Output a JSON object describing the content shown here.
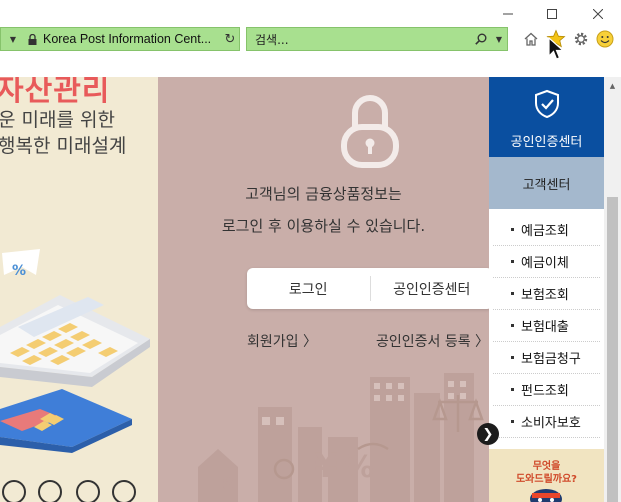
{
  "browser": {
    "address": "Korea Post Information Cent...",
    "search_placeholder": "검색..."
  },
  "banner": {
    "red_title": "자산관리",
    "line1": "운 미래를 위한",
    "line2": "행복한 미래설계"
  },
  "login_panel": {
    "info_line1": "고객님의 금융상품정보는",
    "info_line2": "로그인 후 이용하실 수 있습니다.",
    "login_button": "로그인",
    "cert_button": "공인인증센터",
    "join_link": "회원가입 〉",
    "cert_register_link": "공인인증서 등록 〉"
  },
  "quick_menu": {
    "cert_center": "공인인증센터",
    "customer_center": "고객센터",
    "items": [
      "예금조회",
      "예금이체",
      "보험조회",
      "보험대출",
      "보험금청구",
      "펀드조회",
      "소비자보호"
    ],
    "help_line1": "무엇을",
    "help_line2": "도와드릴까요?"
  },
  "colors": {
    "address_bar": "#a8e08f",
    "quick_menu_blue": "#0a4fa0",
    "customer_center_bg": "#a4b8cd",
    "center_bg": "#c9aea9",
    "left_bg": "#f2ead3"
  }
}
